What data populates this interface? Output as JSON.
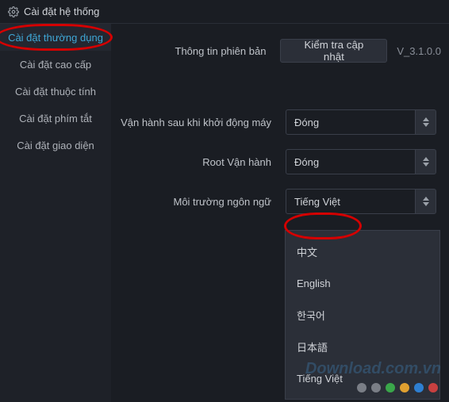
{
  "window": {
    "title": "Cài đặt hệ thống"
  },
  "sidebar": {
    "items": [
      {
        "label": "Cài đặt thường dụng"
      },
      {
        "label": "Cài đặt cao cấp"
      },
      {
        "label": "Cài đặt thuộc tính"
      },
      {
        "label": "Cài đặt phím tắt"
      },
      {
        "label": "Cài đặt giao diện"
      }
    ]
  },
  "main": {
    "version_info_label": "Thông tin phiên bản",
    "check_update_btn": "Kiểm tra cập nhật",
    "version_text": "V_3.1.0.0",
    "run_on_startup_label": "Vận hành sau khi khởi động máy",
    "run_on_startup_value": "Đóng",
    "root_run_label": "Root Vận hành",
    "root_run_value": "Đóng",
    "language_env_label": "Môi trường ngôn ngữ",
    "language_env_value": "Tiếng Việt",
    "language_options": [
      {
        "label": "中文"
      },
      {
        "label": "English"
      },
      {
        "label": "한국어"
      },
      {
        "label": "日本語"
      },
      {
        "label": "Tiếng Việt"
      }
    ]
  },
  "watermark": "Download.com.vn",
  "dots": {
    "colors": [
      "#7a7e86",
      "#7a7e86",
      "#3aa64a",
      "#e0a030",
      "#2e7fd1",
      "#c84040"
    ]
  }
}
